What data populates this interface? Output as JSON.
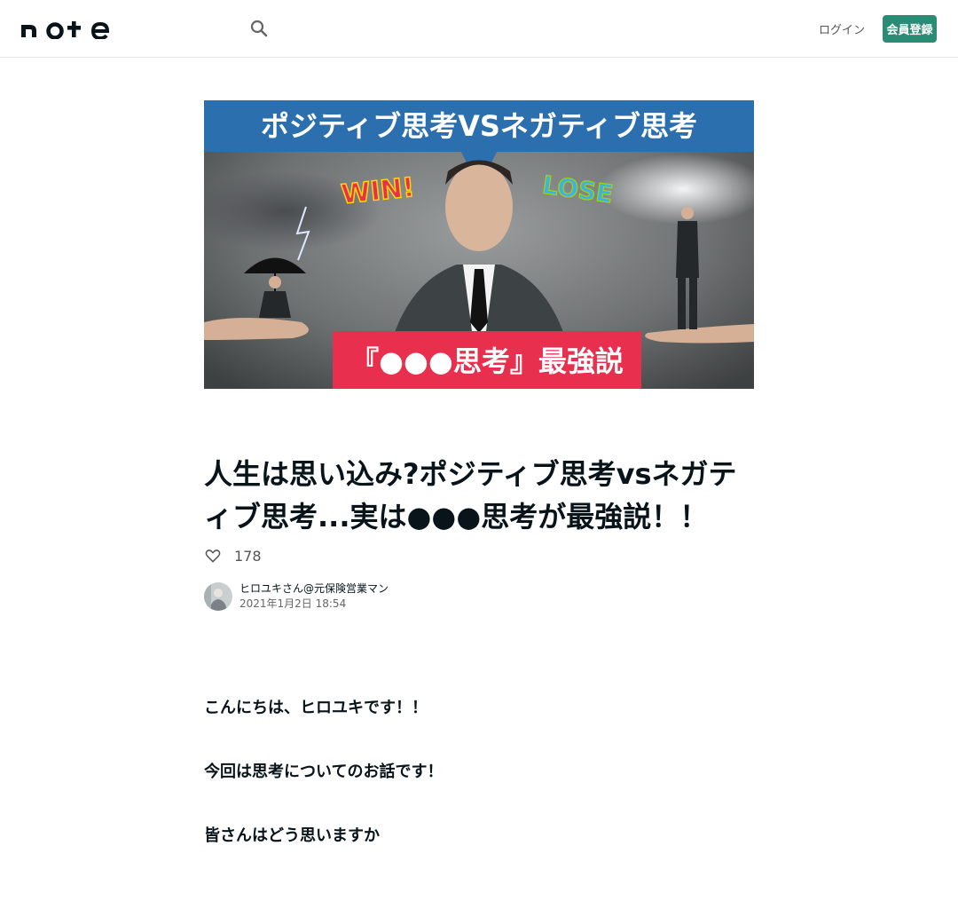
{
  "header": {
    "logo_alt": "note",
    "login_label": "ログイン",
    "signup_label": "会員登録"
  },
  "hero": {
    "banner_title": "ポジティブ思考VSネガティブ思考",
    "win_text": "WIN!",
    "lose_text": "LOSE",
    "footer_text": "『●●●思考』最強説"
  },
  "article": {
    "title": "人生は思い込み?ポジティブ思考vsネガティブ思考...実は●●●思考が最強説！！",
    "like_count": "178",
    "author_name": "ヒロユキさん@元保険営業マン",
    "date": "2021年1月2日 18:54",
    "paragraphs": [
      "こんにちは、ヒロユキです！！",
      "今回は思考についてのお話です！",
      "皆さんはどう思いますか"
    ]
  },
  "colors": {
    "accent": "#2a8c74",
    "banner_blue": "#2b6fae",
    "banner_red": "#e8304e"
  }
}
